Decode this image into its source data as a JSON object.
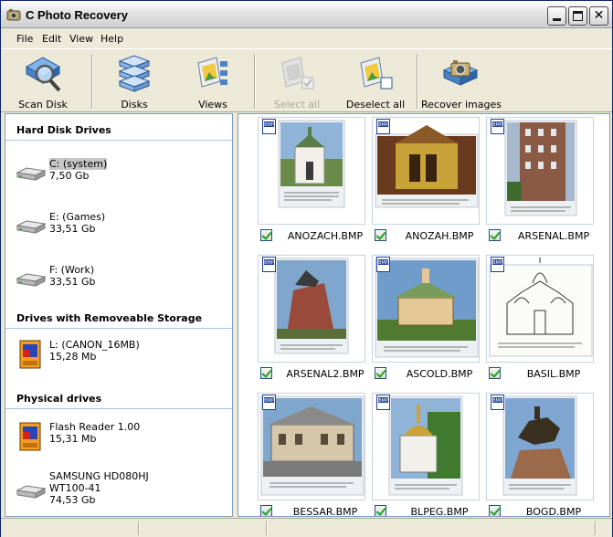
{
  "window": {
    "title": "C Photo Recovery"
  },
  "menu": [
    "File",
    "Edit",
    "View",
    "Help"
  ],
  "toolbar": {
    "scan_disk": "Scan Disk",
    "disks": "Disks",
    "views": "Views",
    "select_all": "Select all",
    "deselect_all": "Deselect all",
    "recover_images": "Recover images"
  },
  "left_panel": {
    "hard_disk_header": "Hard Disk Drives",
    "hard_disks": [
      {
        "name": "C: (system)",
        "size": "7,50 Gb"
      },
      {
        "name": "E: (Games)",
        "size": "33,51 Gb"
      },
      {
        "name": "F: (Work)",
        "size": "33,51 Gb"
      }
    ],
    "removable_header": "Drives with Removeable Storage",
    "removable": [
      {
        "name": "L: (CANON_16MB)",
        "size": "15,28 Mb"
      }
    ],
    "physical_header": "Physical drives",
    "physical": [
      {
        "name": "Flash Reader 1.00",
        "size": "15,31 Mb"
      },
      {
        "name": "SAMSUNG HD080HJ",
        "model": "WT100-41",
        "size": "74,53 Gb"
      }
    ]
  },
  "images": [
    {
      "filename": "ANOZACH.BMP",
      "badge": "BMP",
      "checked": true
    },
    {
      "filename": "ANOZAH.BMP",
      "badge": "BMP",
      "checked": true
    },
    {
      "filename": "ARSENAL.BMP",
      "badge": "BMP",
      "checked": true
    },
    {
      "filename": "ARSENAL2.BMP",
      "badge": "BMP",
      "checked": true
    },
    {
      "filename": "ASCOLD.BMP",
      "badge": "BMP",
      "checked": true
    },
    {
      "filename": "BASIL.BMP",
      "badge": "BMP",
      "checked": true
    },
    {
      "filename": "BESSAR.BMP",
      "badge": "BMP",
      "checked": true
    },
    {
      "filename": "BLPEG.BMP",
      "badge": "BMP",
      "checked": true
    },
    {
      "filename": "BOGD.BMP",
      "badge": "BMP",
      "checked": true
    }
  ],
  "colors": {
    "window_bg": "#ece9d8",
    "panel_border": "#7f9db9",
    "section_rule": "#a7c1e0",
    "selected_bg": "#c6c6c6",
    "check_green": "#21a121",
    "badge_blue": "#1c3e9e"
  }
}
